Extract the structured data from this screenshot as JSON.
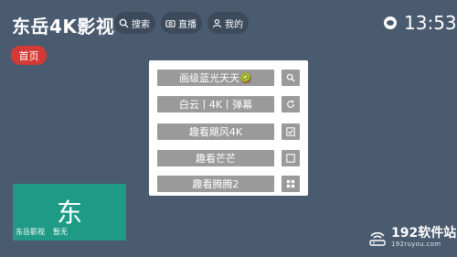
{
  "header": {
    "app_title": "东岳4K影视",
    "nav": [
      {
        "label": "搜索",
        "icon": "search-icon"
      },
      {
        "label": "直播",
        "icon": "tv-icon"
      },
      {
        "label": "我的",
        "icon": "user-icon"
      }
    ],
    "time": "13:53"
  },
  "tabs": {
    "home": "首页"
  },
  "source_panel": {
    "items": [
      "画级蓝光天天🥝",
      "白云丨4K丨弹幕",
      "趣看飓风4K",
      "趣看芒芒",
      "趣看腾腾2"
    ],
    "side_icons": [
      "search-icon",
      "refresh-icon",
      "checkbox-checked-icon",
      "checkbox-empty-icon",
      "grid-icon"
    ]
  },
  "card": {
    "glyph": "东",
    "name": "东岳影视",
    "status": "暂无"
  },
  "watermark": {
    "name": "192软件站",
    "url": "192ruyou.com"
  },
  "colors": {
    "background": "#4a5a6f",
    "accent_red": "#d43a35",
    "card_teal": "#1f9a86",
    "item_gray": "#9a9a9a"
  }
}
